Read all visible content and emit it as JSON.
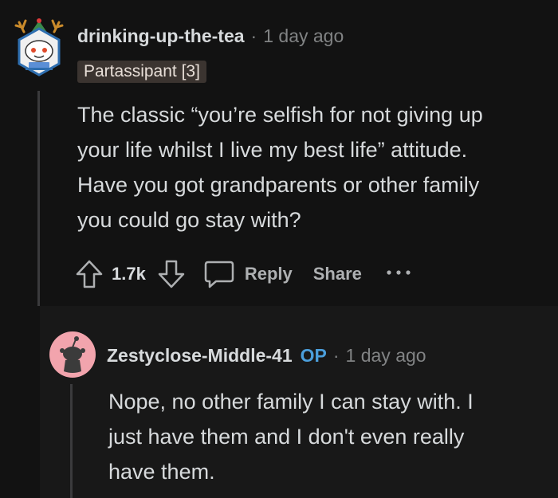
{
  "colors": {
    "background": "#121212",
    "reply_background": "#181818",
    "op_accent": "#4b9fdc",
    "flair_background": "#3b3430",
    "muted_text": "#818384"
  },
  "top_comment": {
    "avatar_icon": "snoo-avatar-with-antlers-icon",
    "username": "drinking-up-the-tea",
    "separator": "·",
    "time": "1 day ago",
    "flair": "Partassipant [3]",
    "body": [
      "The classic “you’re selfish for not giving up",
      "your life whilst I live my best life” attitude.",
      "Have you got grandparents or other family",
      "you could go stay with?"
    ],
    "actions": {
      "upvote_icon": "upvote-arrow-icon",
      "vote_count": "1.7k",
      "downvote_icon": "downvote-arrow-icon",
      "comment_icon": "speech-bubble-icon",
      "reply_label": "Reply",
      "share_label": "Share",
      "more_icon": "ellipsis-icon"
    }
  },
  "reply_comment": {
    "avatar_icon": "default-snoo-avatar-icon",
    "username": "Zestyclose-Middle-41",
    "op_badge": "OP",
    "separator": "·",
    "time": "1 day ago",
    "body": [
      "Nope, no other family I can stay with. I",
      "just have them and I don't even really",
      "have them."
    ]
  }
}
